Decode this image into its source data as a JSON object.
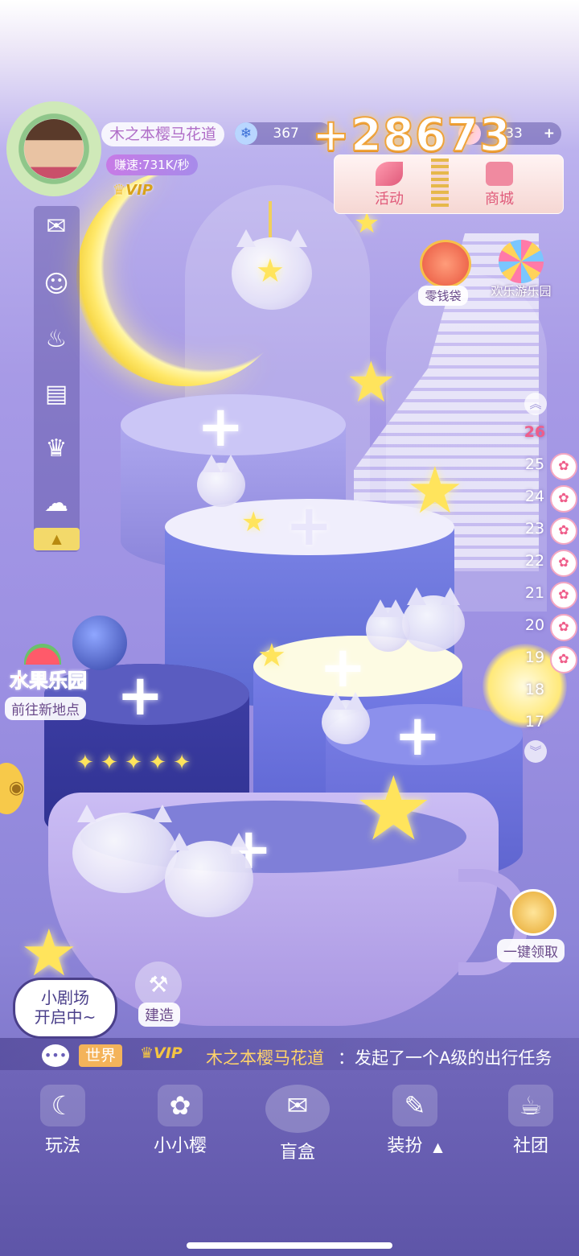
{
  "player": {
    "name": "木之本樱马花道",
    "speed": "赚速:731K/秒",
    "vip": "VIP"
  },
  "resources": {
    "snow": "367",
    "gain_popup": "+28673",
    "crystal": "533",
    "add_symbol": "+"
  },
  "top_panel": {
    "activity": "活动",
    "shop": "商城"
  },
  "shortcuts": {
    "wallet": "零钱袋",
    "amusement_park": "欢乐游乐园"
  },
  "floors": {
    "current": "26",
    "list": [
      "25",
      "24",
      "23",
      "22",
      "21",
      "20",
      "19",
      "18",
      "17"
    ]
  },
  "location": {
    "title": "水果乐园",
    "goto": "前往新地点"
  },
  "collect_all": "一键领取",
  "theater": "小剧场\n开启中~",
  "build": "建造",
  "chat": {
    "channel": "世界",
    "vip": "VIP",
    "sender": "木之本樱马花道",
    "message": "：发起了一个A级的出行任务"
  },
  "nav": {
    "play": "玩法",
    "sakura": "小小樱",
    "blindbox": "盲盒",
    "dressup": "装扮",
    "dressup_arrow": "▲",
    "club": "社团"
  },
  "icons": [
    "mail-icon",
    "friends-icon",
    "bag-icon",
    "notice-icon",
    "trophy-icon",
    "wechat-icon"
  ],
  "colors": {
    "background": "#9b8fe2",
    "accent_pink": "#ef5d8a",
    "gold": "#f7d84a"
  }
}
